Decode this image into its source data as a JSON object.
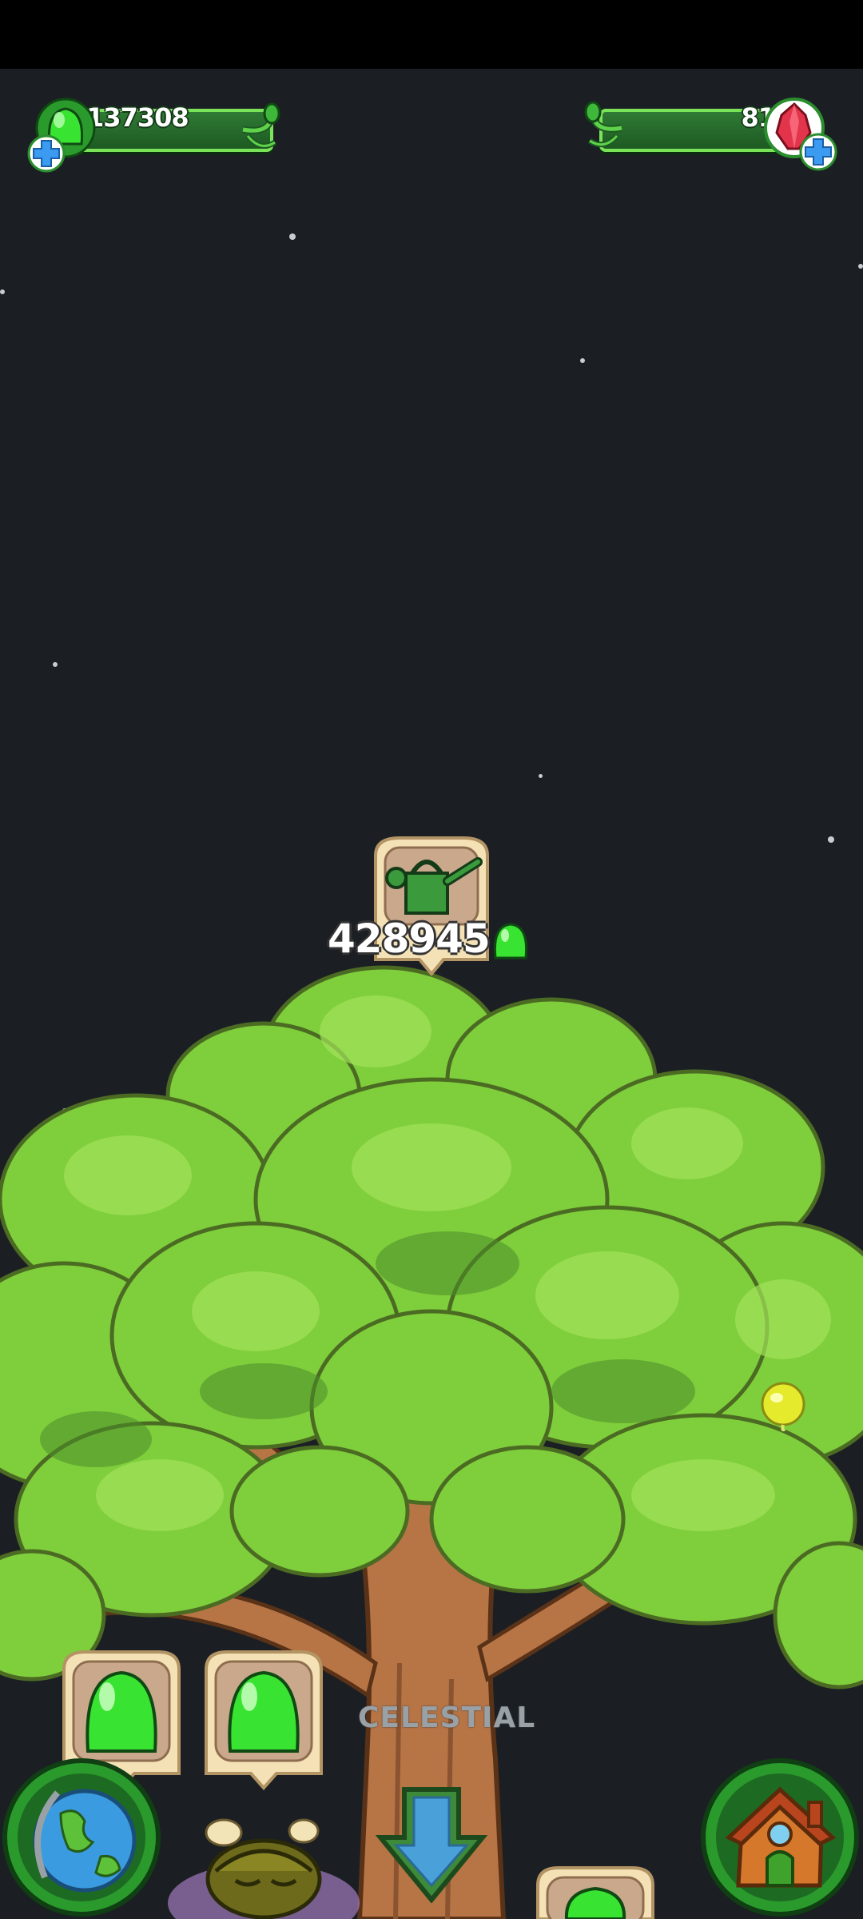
{
  "status_bar": {},
  "currencies": {
    "jelly": {
      "value": "137308",
      "icon": "green-jelly-icon"
    },
    "gems": {
      "value": "81",
      "icon": "red-crystal-icon"
    }
  },
  "tree": {
    "watering_cost": "428945",
    "watering_icon": "watering-can-icon",
    "cost_icon": "green-jelly-icon",
    "zone_label": "CELESTIAL"
  },
  "buttons": {
    "map": "globe-icon",
    "home": "house-icon",
    "scroll_down": "down-arrow-icon"
  },
  "colors": {
    "background": "#1b1f24",
    "bar_fill": "#2f7a34",
    "bar_border": "#7be35a",
    "jelly_green": "#39e332",
    "leaf_green": "#7fce3c",
    "trunk_brown": "#b77546"
  }
}
